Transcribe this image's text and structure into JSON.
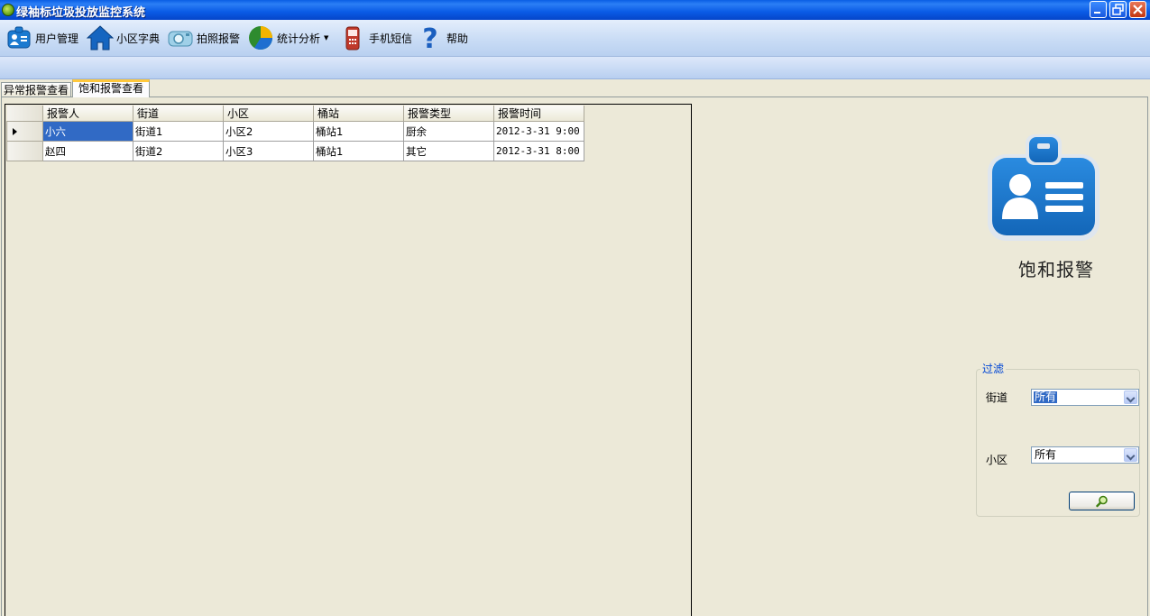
{
  "window": {
    "title": "绿袖标垃圾投放监控系统"
  },
  "toolbar": {
    "items": [
      {
        "label": "用户管理",
        "icon": "id-card-icon"
      },
      {
        "label": "小区字典",
        "icon": "house-icon"
      },
      {
        "label": "拍照报警",
        "icon": "camera-icon"
      },
      {
        "label": "统计分析",
        "icon": "pie-chart-icon",
        "dropdown": true
      },
      {
        "label": "手机短信",
        "icon": "mobile-phone-icon"
      },
      {
        "label": "帮助",
        "icon": "help-icon"
      }
    ]
  },
  "tabs": [
    {
      "label": "异常报警查看",
      "active": false
    },
    {
      "label": "饱和报警查看",
      "active": true
    }
  ],
  "grid": {
    "columns": [
      "报警人",
      "街道",
      "小区",
      "桶站",
      "报警类型",
      "报警时间"
    ],
    "rows": [
      [
        "小六",
        "街道1",
        "小区2",
        "桶站1",
        "厨余",
        "2012-3-31 9:00"
      ],
      [
        "赵四",
        "街道2",
        "小区3",
        "桶站1",
        "其它",
        "2012-3-31 8:00"
      ]
    ],
    "selected_row": 0
  },
  "panel": {
    "title": "饱和报警",
    "icon": "id-card-icon"
  },
  "filter": {
    "legend": "过滤",
    "street_label": "街道",
    "street_value": "所有",
    "community_label": "小区",
    "community_value": "所有",
    "search_icon": "magnifier-icon"
  },
  "colors": {
    "titlebar": "#0a5ee4",
    "selection": "#316ac5",
    "window_bg": "#ece9d8",
    "accent_blue": "#1b7ad0"
  }
}
